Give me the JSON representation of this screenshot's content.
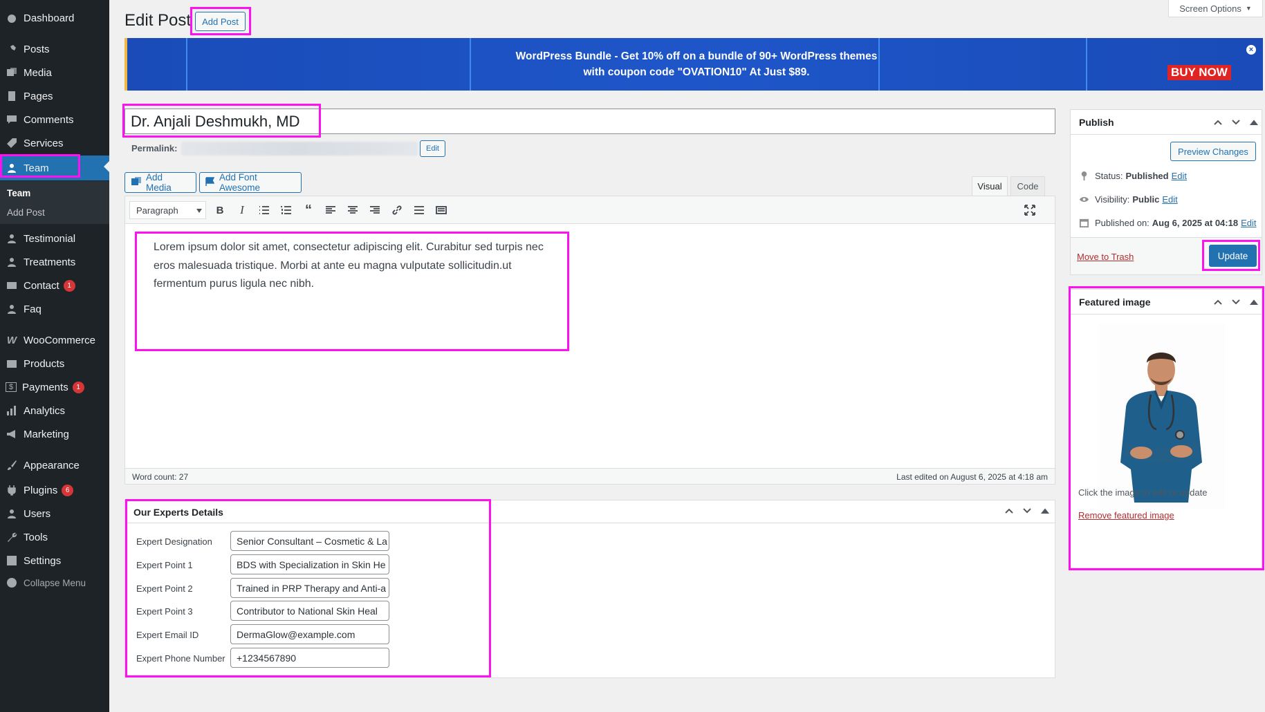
{
  "sidebar": {
    "items": [
      {
        "label": "Dashboard",
        "icon": "dashboard-icon"
      },
      {
        "label": "Posts",
        "icon": "pin-icon"
      },
      {
        "label": "Media",
        "icon": "media-icon"
      },
      {
        "label": "Pages",
        "icon": "pages-icon"
      },
      {
        "label": "Comments",
        "icon": "comments-icon"
      },
      {
        "label": "Services",
        "icon": "tag-icon"
      },
      {
        "label": "Team",
        "icon": "user-icon"
      },
      {
        "label": "Testimonial",
        "icon": "user-icon"
      },
      {
        "label": "Treatments",
        "icon": "user-icon"
      },
      {
        "label": "Contact",
        "icon": "mail-icon",
        "badge": "1"
      },
      {
        "label": "Faq",
        "icon": "user-icon"
      },
      {
        "label": "WooCommerce",
        "icon": "woo-icon"
      },
      {
        "label": "Products",
        "icon": "box-icon"
      },
      {
        "label": "Payments",
        "icon": "dollar-icon",
        "badge": "1"
      },
      {
        "label": "Analytics",
        "icon": "bar-chart-icon"
      },
      {
        "label": "Marketing",
        "icon": "megaphone-icon"
      },
      {
        "label": "Appearance",
        "icon": "brush-icon"
      },
      {
        "label": "Plugins",
        "icon": "plug-icon",
        "badge": "6"
      },
      {
        "label": "Users",
        "icon": "user-icon"
      },
      {
        "label": "Tools",
        "icon": "wrench-icon"
      },
      {
        "label": "Settings",
        "icon": "settings-icon"
      }
    ],
    "submenu": {
      "title": "Team",
      "add": "Add Post"
    },
    "collapse": "Collapse Menu"
  },
  "header": {
    "title": "Edit Post",
    "add_post": "Add Post",
    "screen_options": "Screen Options"
  },
  "banner": {
    "line1": "WordPress Bundle - Get 10% off on a bundle of 90+ WordPress themes",
    "line2": "with coupon code \"OVATION10\" At Just $89.",
    "cta": "BUY NOW",
    "close": "×"
  },
  "post": {
    "title": "Dr. Anjali Deshmukh, MD",
    "permalink_label": "Permalink:",
    "permalink_edit": "Edit"
  },
  "media": {
    "add_media": "Add Media",
    "add_font_awesome": "Add Font Awesome"
  },
  "editor": {
    "tab_visual": "Visual",
    "tab_code": "Code",
    "format": "Paragraph",
    "content": "Lorem ipsum dolor sit amet, consectetur adipiscing elit. Curabitur sed turpis nec eros malesuada tristique. Morbi at ante eu magna vulputate sollicitudin.ut fermentum purus ligula nec nibh.",
    "word_count": "Word count: 27",
    "last_edited": "Last edited on August 6, 2025 at 4:18 am"
  },
  "experts": {
    "title": "Our Experts Details",
    "fields": [
      {
        "label": "Expert Designation",
        "value": "Senior Consultant – Cosmetic & La"
      },
      {
        "label": "Expert Point 1",
        "value": "BDS with Specialization in Skin He"
      },
      {
        "label": "Expert Point 2",
        "value": "Trained in PRP Therapy and Anti-a"
      },
      {
        "label": "Expert Point 3",
        "value": "Contributor to National Skin Heal"
      },
      {
        "label": "Expert Email ID",
        "value": "DermaGlow@example.com"
      },
      {
        "label": "Expert Phone Number",
        "value": "+1234567890"
      }
    ]
  },
  "publish": {
    "title": "Publish",
    "preview": "Preview Changes",
    "status_label": "Status:",
    "status_value": "Published",
    "visibility_label": "Visibility:",
    "visibility_value": "Public",
    "published_label": "Published on:",
    "published_value": "Aug 6, 2025 at 04:18",
    "edit": "Edit",
    "trash": "Move to Trash",
    "update": "Update"
  },
  "featured": {
    "title": "Featured image",
    "hint": "Click the image to edit or update",
    "remove": "Remove featured image"
  },
  "colors": {
    "sidebar_bg": "#1d2327",
    "accent": "#2271b1",
    "highlight": "#ff10f0",
    "badge": "#d63638"
  }
}
